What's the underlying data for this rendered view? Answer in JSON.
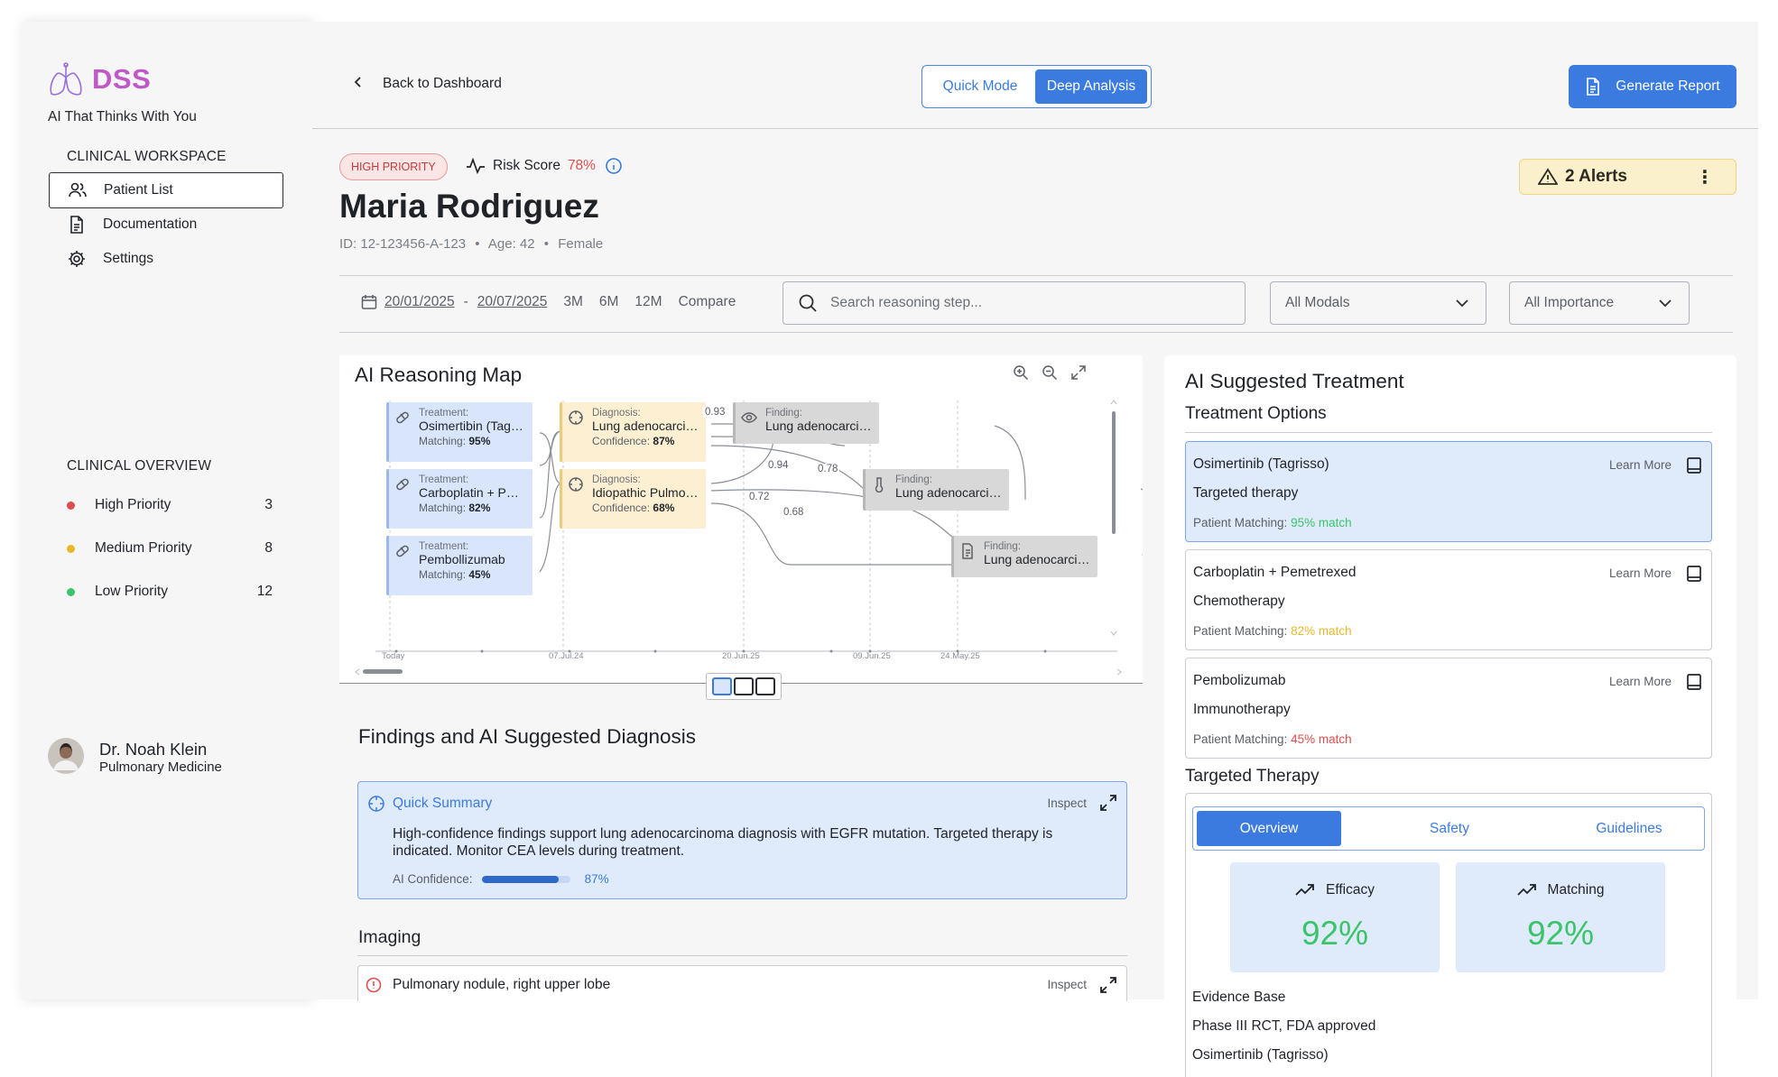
{
  "sidebar": {
    "brand": "DSS",
    "tagline": "AI That Thinks With You",
    "workspace_label": "CLINICAL WORKSPACE",
    "nav": [
      {
        "label": "Patient List",
        "icon": "users-icon",
        "active": true
      },
      {
        "label": "Documentation",
        "icon": "document-icon",
        "active": false
      },
      {
        "label": "Settings",
        "icon": "gear-icon",
        "active": false
      }
    ],
    "overview_label": "CLINICAL OVERVIEW",
    "priorities": [
      {
        "label": "High Priority",
        "count": "3",
        "color": "#e34c4c"
      },
      {
        "label": "Medium Priority",
        "count": "8",
        "color": "#e9b82a"
      },
      {
        "label": "Low Priority",
        "count": "12",
        "color": "#3cc46b"
      }
    ],
    "doctor": {
      "name": "Dr. Noah Klein",
      "department": "Pulmonary Medicine"
    }
  },
  "topbar": {
    "back_label": "Back to Dashboard",
    "modes": {
      "quick": "Quick Mode",
      "deep": "Deep Analysis",
      "selected": "deep"
    },
    "generate_label": "Generate Report"
  },
  "patient": {
    "priority_badge": "HIGH PRIORITY",
    "risk_label": "Risk Score",
    "risk_value": "78%",
    "name": "Maria Rodriguez",
    "id": "ID: 12-123456-A-123",
    "age": "Age: 42",
    "sex": "Female",
    "alerts": "2 Alerts"
  },
  "filters": {
    "date_from": "20/01/2025",
    "date_to": "20/07/2025",
    "ranges": [
      "3M",
      "6M",
      "12M",
      "Compare"
    ],
    "search_placeholder": "Search reasoning step...",
    "modals": "All Modals",
    "importance": "All Importance"
  },
  "map": {
    "title": "AI Reasoning Map",
    "nodes": {
      "t1": {
        "caption": "Treatment:",
        "title": "Osimertibin (Tag…",
        "metric_label": "Matching:",
        "metric_value": "95%"
      },
      "t2": {
        "caption": "Treatment:",
        "title": "Carboplatin + Pe…",
        "metric_label": "Matching:",
        "metric_value": "82%"
      },
      "t3": {
        "caption": "Treatment:",
        "title": "Pembollizumab",
        "metric_label": "Matching:",
        "metric_value": "45%"
      },
      "d1": {
        "caption": "Diagnosis:",
        "title": "Lung adenocarcin…",
        "metric_label": "Confidence:",
        "metric_value": "87%"
      },
      "d2": {
        "caption": "Diagnosis:",
        "title": "Idiopathic Pulmon…",
        "metric_label": "Confidence:",
        "metric_value": "68%"
      },
      "f1": {
        "caption": "Finding:",
        "title": "Lung adenocarcin…"
      },
      "f2": {
        "caption": "Finding:",
        "title": "Lung adenocarcin…"
      },
      "f3": {
        "caption": "Finding:",
        "title": "Lung adenocarcin…"
      }
    },
    "edge_labels": [
      "0.93",
      "0.94",
      "0.78",
      "0.72",
      "0.68"
    ],
    "axis_labels": [
      "Today",
      "07.Jul.24",
      "20.Jun.25",
      "09.Jun.25",
      "24.May.25"
    ]
  },
  "findings": {
    "title": "Findings and AI Suggested Diagnosis",
    "summary_title": "Quick Summary",
    "inspect": "Inspect",
    "summary_text": "High-confidence findings support lung adenocarcinoma diagnosis with EGFR mutation. Targeted therapy is indicated. Monitor CEA levels during treatment.",
    "confidence_label": "AI Confidence:",
    "confidence_value": "87%",
    "confidence_fraction": 0.87,
    "imaging_title": "Imaging",
    "imaging_item": "Pulmonary nodule, right upper lobe"
  },
  "treatment": {
    "title": "AI Suggested Treatment",
    "options_title": "Treatment Options",
    "learn_more": "Learn More",
    "match_label": "Patient Matching:",
    "options": [
      {
        "name": "Osimertinib (Tagrisso)",
        "type": "Targeted therapy",
        "match": "95% match",
        "match_color": "#3cc46b"
      },
      {
        "name": "Carboplatin + Pemetrexed",
        "type": "Chemotherapy",
        "match": "82% match",
        "match_color": "#e9b82a"
      },
      {
        "name": "Pembolizumab",
        "type": "Immunotherapy",
        "match": "45% match",
        "match_color": "#e34c4c"
      }
    ],
    "targeted_title": "Targeted Therapy",
    "tabs": [
      "Overview",
      "Safety",
      "Guidelines"
    ],
    "metrics": [
      {
        "label": "Efficacy",
        "value": "92%"
      },
      {
        "label": "Matching",
        "value": "92%"
      }
    ],
    "evidence_title": "Evidence Base",
    "evidence_text": "Phase III RCT, FDA approved",
    "evidence_drug": "Osimertinib (Tagrisso)"
  }
}
